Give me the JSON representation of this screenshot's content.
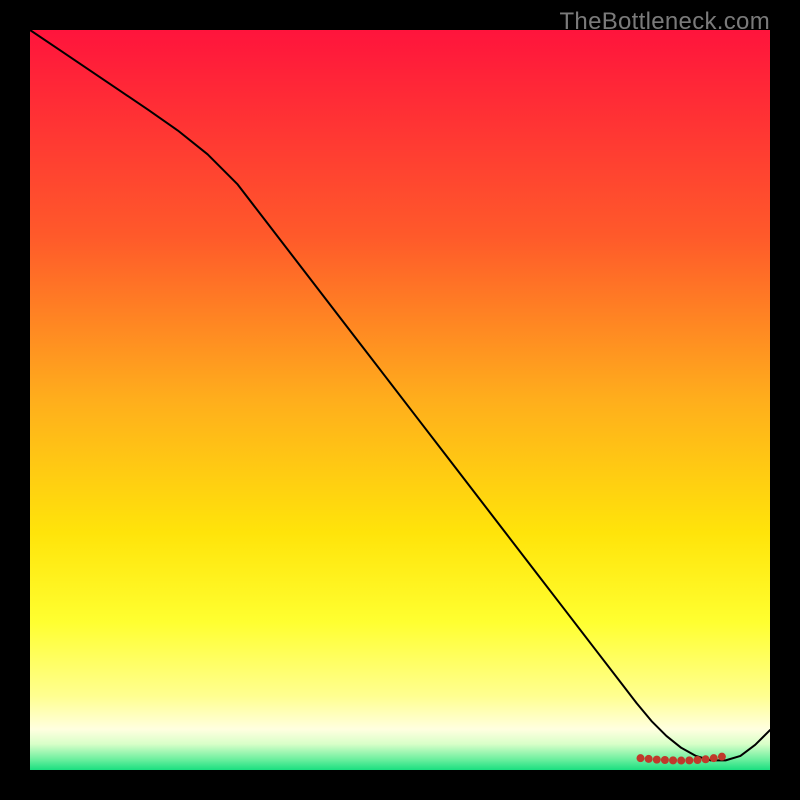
{
  "watermark": "TheBottleneck.com",
  "chart_data": {
    "type": "line",
    "title": "",
    "xlabel": "",
    "ylabel": "",
    "xlim": [
      0,
      100
    ],
    "ylim": [
      0,
      100
    ],
    "grid": false,
    "legend": false,
    "background_gradient": {
      "stops": [
        {
          "offset": 0.0,
          "color": "#ff143c"
        },
        {
          "offset": 0.28,
          "color": "#ff5a2a"
        },
        {
          "offset": 0.5,
          "color": "#ffae1c"
        },
        {
          "offset": 0.68,
          "color": "#ffe40a"
        },
        {
          "offset": 0.8,
          "color": "#ffff30"
        },
        {
          "offset": 0.9,
          "color": "#ffff90"
        },
        {
          "offset": 0.945,
          "color": "#ffffe0"
        },
        {
          "offset": 0.965,
          "color": "#d8ffc8"
        },
        {
          "offset": 0.985,
          "color": "#70f0a0"
        },
        {
          "offset": 1.0,
          "color": "#1adf80"
        }
      ]
    },
    "series": [
      {
        "name": "curve",
        "color": "#000000",
        "width": 2,
        "x": [
          0,
          4,
          8,
          12,
          16,
          20,
          24,
          28,
          32,
          36,
          40,
          44,
          48,
          52,
          56,
          60,
          64,
          68,
          72,
          76,
          80,
          82,
          84,
          86,
          88,
          90,
          92,
          94,
          96,
          98,
          100
        ],
        "y": [
          100,
          97.3,
          94.6,
          91.9,
          89.2,
          86.4,
          83.2,
          79.2,
          74.0,
          68.8,
          63.6,
          58.4,
          53.2,
          48.0,
          42.8,
          37.6,
          32.4,
          27.2,
          22.0,
          16.8,
          11.6,
          9.0,
          6.6,
          4.6,
          3.0,
          1.9,
          1.3,
          1.3,
          1.9,
          3.4,
          5.4
        ]
      }
    ],
    "markers": {
      "name": "flat-region-dots",
      "color": "#c0392b",
      "radius": 4,
      "x": [
        82.5,
        83.6,
        84.7,
        85.8,
        86.9,
        88.0,
        89.1,
        90.2,
        91.3,
        92.4,
        93.5
      ],
      "y": [
        1.6,
        1.5,
        1.4,
        1.35,
        1.3,
        1.28,
        1.3,
        1.35,
        1.45,
        1.6,
        1.8
      ]
    }
  }
}
